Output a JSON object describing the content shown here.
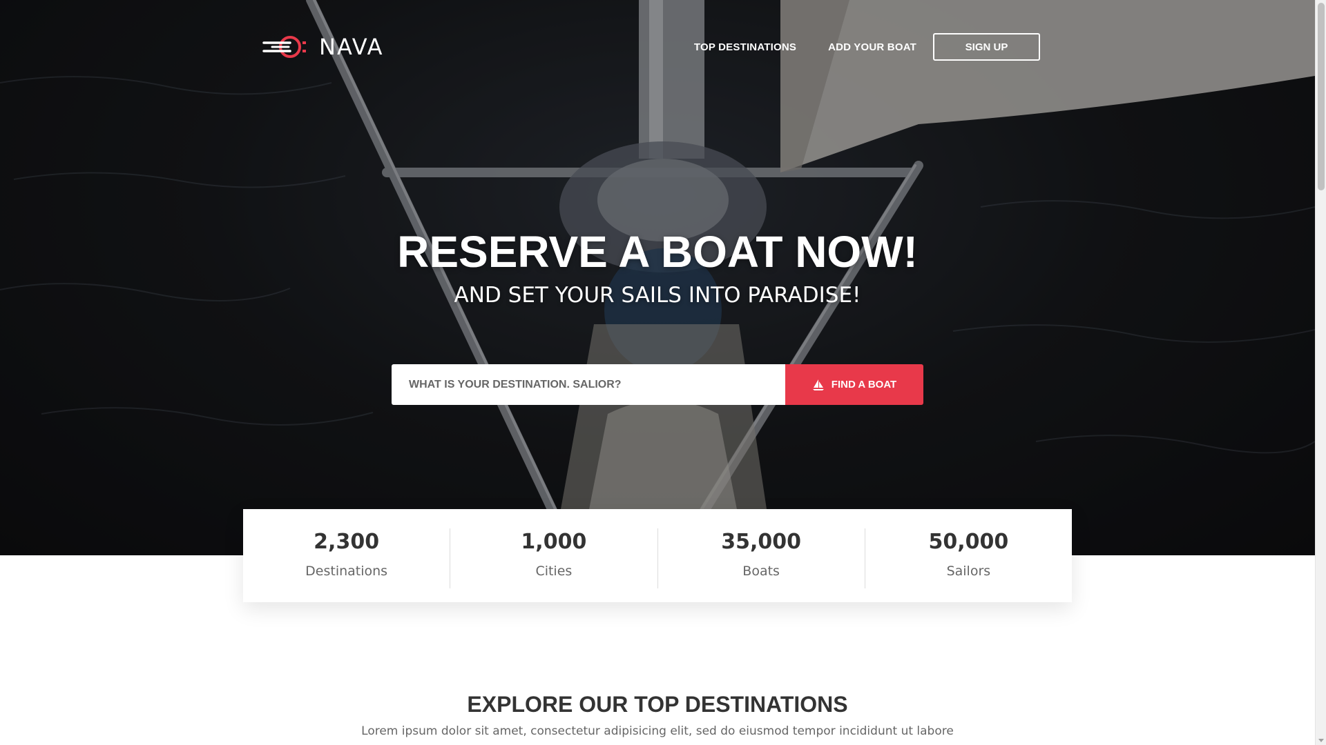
{
  "brand": {
    "name": "NAVA",
    "accent_color": "#e8394a"
  },
  "nav": {
    "links": [
      "TOP DESTINATIONS",
      "ADD YOUR BOAT"
    ],
    "signup_label": "SIGN UP"
  },
  "hero": {
    "headline": "RESERVE A BOAT NOW!",
    "subheadline": "AND SET YOUR SAILS INTO PARADISE!",
    "search_placeholder": "WHAT IS YOUR DESTINATION. SALIOR?",
    "search_value": "",
    "find_button_label": "FIND A BOAT",
    "find_button_icon": "sailboat-icon"
  },
  "stats": [
    {
      "value": "2,300",
      "label": "Destinations"
    },
    {
      "value": "1,000",
      "label": "Cities"
    },
    {
      "value": "35,000",
      "label": "Boats"
    },
    {
      "value": "50,000",
      "label": "Sailors"
    }
  ],
  "explore": {
    "title": "EXPLORE OUR TOP DESTINATIONS",
    "description": "Lorem ipsum dolor sit amet, consectetur adipisicing elit, sed do eiusmod tempor incididunt ut labore"
  }
}
